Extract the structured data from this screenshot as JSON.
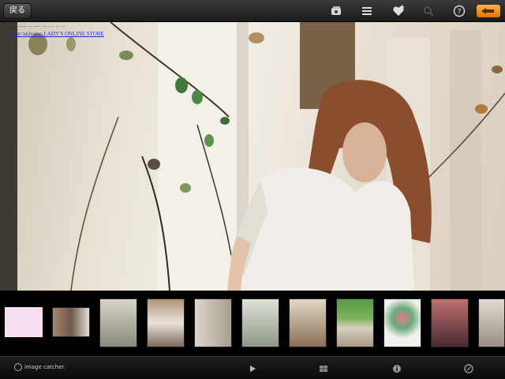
{
  "toolbar": {
    "back_label": "戻る",
    "icons": [
      "photo-album-icon",
      "list-icon",
      "favorite-heart-icon",
      "search-icon",
      "help-icon",
      "back-arrow-icon"
    ],
    "accent_color": "#f08a00"
  },
  "photo": {
    "link_lines": [
      "·· ·······  ·· ···· ··· ··· ·· ··",
      "more=univers= LADY'S ONLINE STORE"
    ]
  },
  "thumbnails": [
    {
      "fill": "#f7dff2"
    },
    {
      "fill": "#8a7060"
    },
    {
      "fill": "#a8a49a"
    },
    {
      "fill": "#9c8570"
    },
    {
      "fill": "#c9bfb2"
    },
    {
      "fill": "#9aa090"
    },
    {
      "fill": "#b7a38f"
    },
    {
      "fill": "#5d8a4a"
    },
    {
      "fill": "#e9e6e1"
    },
    {
      "fill": "#8a5050"
    },
    {
      "fill": "#d4ccc0"
    }
  ],
  "bottombar": {
    "brand_label": "image catcher.",
    "icons": [
      "play-icon",
      "grid-icon",
      "info-icon",
      "settings-icon"
    ]
  }
}
